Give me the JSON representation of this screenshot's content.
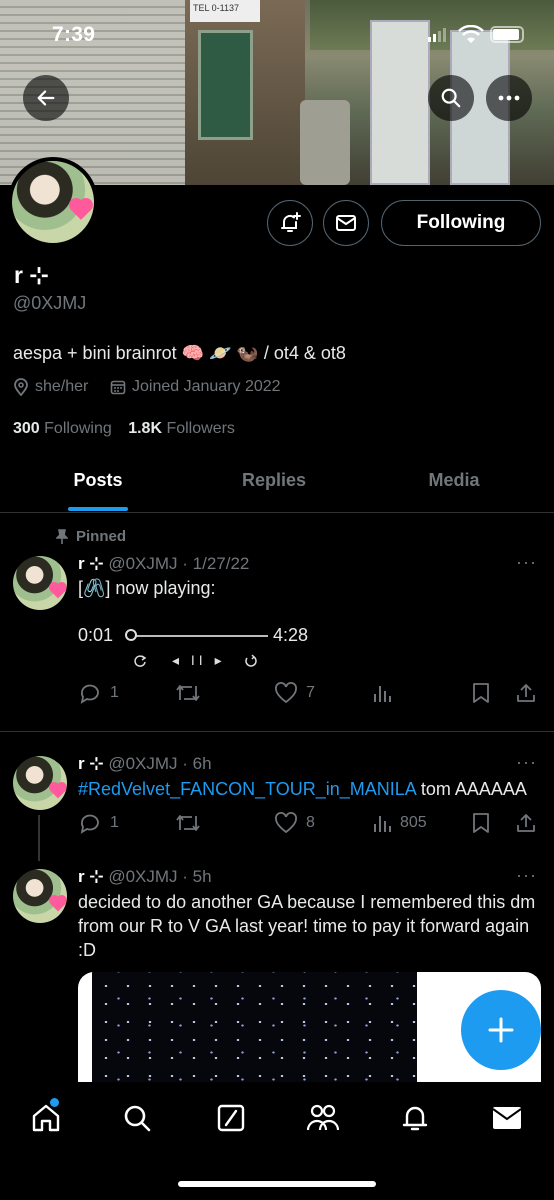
{
  "status_bar": {
    "time": "7:39"
  },
  "banner": {
    "sign_text": "TEL 0-1137"
  },
  "profile": {
    "name": "r ⊹",
    "handle": "@0XJMJ",
    "bio": "aespa + bini brainrot 🧠 🪐 🦦  / ot4 & ot8",
    "pronouns": "she/her",
    "joined": "Joined January 2022",
    "following_count": "300",
    "following_label": "Following",
    "followers_count": "1.8K",
    "followers_label": "Followers",
    "follow_button_label": "Following"
  },
  "tabs": [
    {
      "label": "Posts"
    },
    {
      "label": "Replies"
    },
    {
      "label": "Media"
    }
  ],
  "tweets": [
    {
      "pinned_label": "Pinned",
      "name": "r ⊹",
      "meta": "@0XJMJ · 1/27/22",
      "text": "[🖇️] now playing:",
      "player_start": "0:01",
      "player_end": "4:28",
      "player_controls": "◂ II ▸",
      "replies": "1",
      "retweets": "",
      "likes": "7",
      "views": ""
    },
    {
      "name": "r ⊹",
      "meta": "@0XJMJ · 6h",
      "hashtag": "#RedVelvet_FANCON_TOUR_in_MANILA",
      "text_after": " tom AAAAAA",
      "replies": "1",
      "retweets": "",
      "likes": "8",
      "views": "805"
    },
    {
      "name": "r ⊹",
      "meta": "@0XJMJ · 5h",
      "text": "decided to do another GA because I remembered this dm from our R to V GA last year! time to pay it forward again :D"
    }
  ],
  "colors": {
    "accent": "#1d9bf0",
    "muted": "#71767b",
    "background": "#000000"
  },
  "icons": [
    "back-arrow-icon",
    "search-icon",
    "more-icon",
    "bell-plus-icon",
    "mail-icon",
    "location-icon",
    "calendar-icon",
    "pin-icon",
    "reply-icon",
    "retweet-icon",
    "like-icon",
    "views-icon",
    "bookmark-icon",
    "share-icon",
    "compose-plus-icon",
    "home-icon",
    "explore-icon",
    "grok-icon",
    "communities-icon",
    "notifications-icon",
    "messages-icon"
  ]
}
